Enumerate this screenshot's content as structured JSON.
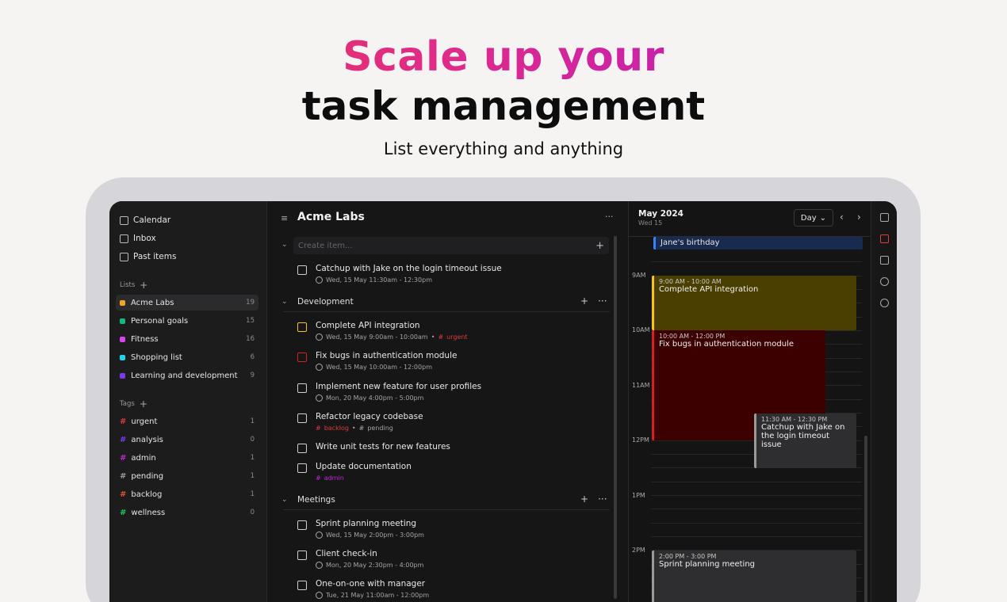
{
  "hero": {
    "line1": "Scale up your",
    "line2": "task management",
    "subtitle": "List everything and anything"
  },
  "sidebar": {
    "nav": [
      {
        "label": "Calendar",
        "icon": "calendar-icon"
      },
      {
        "label": "Inbox",
        "icon": "inbox-icon"
      },
      {
        "label": "Past items",
        "icon": "archive-icon"
      }
    ],
    "lists_heading": "Lists",
    "lists": [
      {
        "label": "Acme Labs",
        "count": "19",
        "color": "#f5a524"
      },
      {
        "label": "Personal goals",
        "count": "15",
        "color": "#10b981"
      },
      {
        "label": "Fitness",
        "count": "16",
        "color": "#d946ef"
      },
      {
        "label": "Shopping list",
        "count": "6",
        "color": "#22d3ee"
      },
      {
        "label": "Learning and development",
        "count": "9",
        "color": "#7c3aed"
      }
    ],
    "tags_heading": "Tags",
    "tags": [
      {
        "label": "urgent",
        "count": "1",
        "color": "#e03a3a"
      },
      {
        "label": "analysis",
        "count": "0",
        "color": "#7c3aed"
      },
      {
        "label": "admin",
        "count": "1",
        "color": "#c026d3"
      },
      {
        "label": "pending",
        "count": "1",
        "color": "#9a9a9a"
      },
      {
        "label": "backlog",
        "count": "1",
        "color": "#e0552a"
      },
      {
        "label": "wellness",
        "count": "0",
        "color": "#22c55e"
      }
    ]
  },
  "middle": {
    "title": "Acme Labs",
    "create_placeholder": "Create item...",
    "ungrouped": [
      {
        "title": "Catchup with Jake on the login timeout issue",
        "date": "Wed, 15 May 11:30am - 12:30pm"
      }
    ],
    "groups": [
      {
        "label": "Development",
        "tasks": [
          {
            "title": "Complete API integration",
            "date": "Wed, 15 May 9:00am - 10:00am",
            "tag": "urgent"
          },
          {
            "title": "Fix bugs in authentication module",
            "date": "Wed, 15 May 10:00am - 12:00pm"
          },
          {
            "title": "Implement new feature for user profiles",
            "date": "Mon, 20 May 4:00pm - 5:00pm"
          },
          {
            "title": "Refactor legacy codebase",
            "tag1": "backlog",
            "tag2": "pending"
          },
          {
            "title": "Write unit tests for new features"
          },
          {
            "title": "Update documentation",
            "tag": "admin"
          }
        ]
      },
      {
        "label": "Meetings",
        "tasks": [
          {
            "title": "Sprint planning meeting",
            "date": "Wed, 15 May 2:00pm - 3:00pm"
          },
          {
            "title": "Client check-in",
            "date": "Mon, 20 May 2:30pm - 4:00pm"
          },
          {
            "title": "One-on-one with manager",
            "date": "Tue, 21 May 11:00am - 12:00pm"
          }
        ]
      }
    ]
  },
  "calendar": {
    "month": "May 2024",
    "day": "Wed 15",
    "view": "Day",
    "allday_event": "Jane's birthday",
    "hours": [
      "9AM",
      "10AM",
      "11AM",
      "12PM",
      "1PM",
      "2PM"
    ],
    "events": [
      {
        "time": "9:00 AM - 10:00 AM",
        "title": "Complete API integration"
      },
      {
        "time": "10:00 AM - 12:00 PM",
        "title": "Fix bugs in authentication module"
      },
      {
        "time": "11:30 AM - 12:30 PM",
        "title": "Catchup with Jake on the login timeout issue"
      },
      {
        "time": "2:00 PM - 3:00 PM",
        "title": "Sprint planning meeting"
      }
    ]
  }
}
